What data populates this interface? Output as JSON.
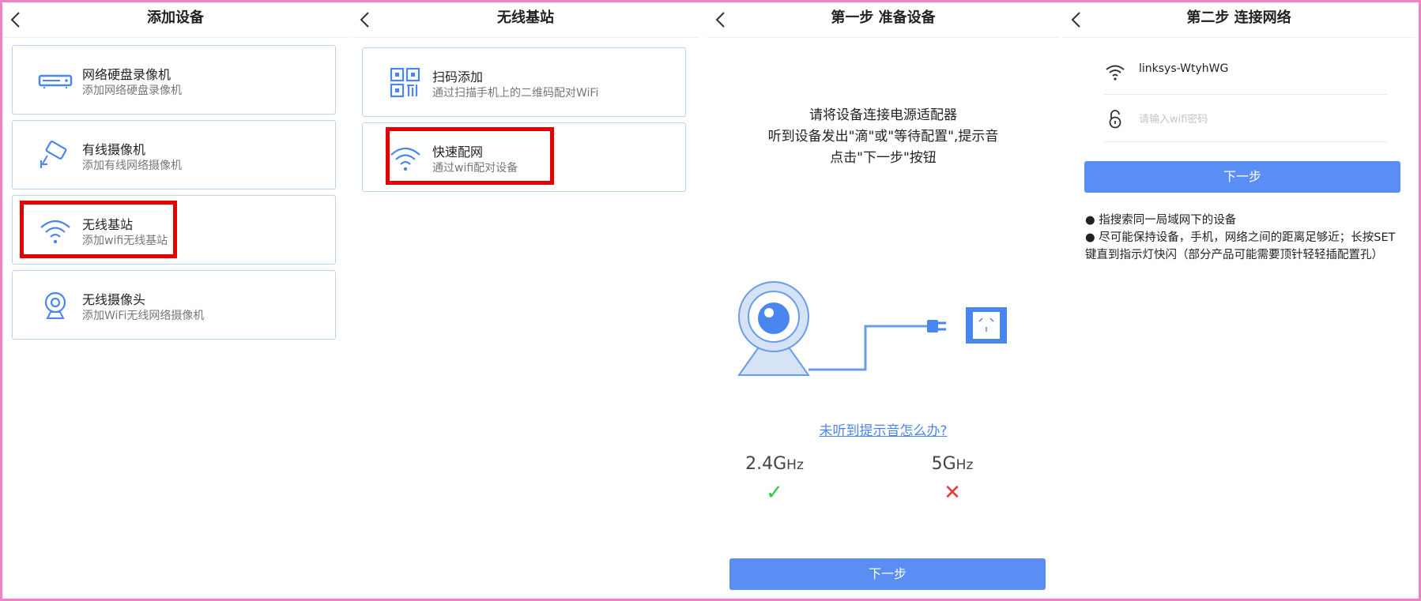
{
  "colors": {
    "accent": "#5b8ef5",
    "card_border": "#b9d4f2",
    "highlight": "#e60000",
    "frame": "#f080c8",
    "check": "#2ecc40",
    "cross": "#e53935"
  },
  "panel1": {
    "title": "添加设备",
    "items": [
      {
        "name": "网络硬盘录像机",
        "desc": "添加网络硬盘录像机",
        "icon": "nvr-icon"
      },
      {
        "name": "有线摄像机",
        "desc": "添加有线网络摄像机",
        "icon": "wired-camera-icon"
      },
      {
        "name": "无线基站",
        "desc": "添加wifi无线基站",
        "icon": "wifi-icon"
      },
      {
        "name": "无线摄像头",
        "desc": "添加WiFi无线网络摄像机",
        "icon": "wireless-camera-icon"
      }
    ]
  },
  "panel2": {
    "title": "无线基站",
    "items": [
      {
        "name": "扫码添加",
        "desc": "通过扫描手机上的二维码配对WiFi",
        "icon": "qr-code-icon"
      },
      {
        "name": "快速配网",
        "desc": "通过wifi配对设备",
        "icon": "wifi-icon"
      }
    ]
  },
  "panel3": {
    "title": "第一步 准备设备",
    "instructions": [
      "请将设备连接电源适配器",
      "听到设备发出\"滴\"或\"等待配置\",提示音",
      "点击\"下一步\"按钮"
    ],
    "help_link": "未听到提示音怎么办?",
    "freq_24": {
      "main": "2.4G",
      "suffix": "Hz",
      "status": "✓"
    },
    "freq_5": {
      "main": "5G",
      "suffix": "Hz",
      "status": "✕"
    },
    "next_label": "下一步"
  },
  "panel4": {
    "title": "第二步 连接网络",
    "ssid": "linksys-WtyhWG",
    "password_placeholder": "请输入wifi密码",
    "next_label": "下一步",
    "notes": [
      "● 指搜索同一局域网下的设备",
      "● 尽可能保持设备，手机，网络之间的距离足够近；长按SET键直到指示灯快闪（部分产品可能需要顶针轻轻插配置孔）"
    ]
  }
}
